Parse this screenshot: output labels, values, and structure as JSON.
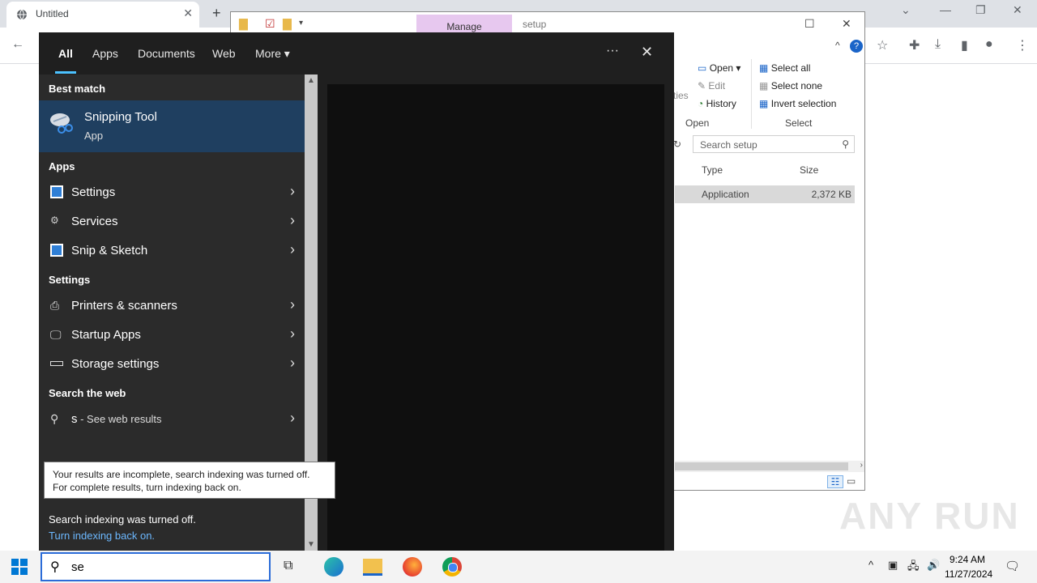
{
  "chrome": {
    "tab_title": "Untitled",
    "tab_close": "✕",
    "new_tab": "+"
  },
  "explorer": {
    "manage_tab": "Manage",
    "window_title": "setup",
    "ribbon": {
      "open": "Open",
      "edit": "Edit",
      "history": "History",
      "properties_partial": "rties",
      "open_group": "Open",
      "select_all": "Select all",
      "select_none": "Select none",
      "invert_selection": "Invert selection",
      "select_group": "Select"
    },
    "search_placeholder": "Search setup",
    "columns": {
      "type": "Type",
      "size": "Size"
    },
    "row": {
      "type": "Application",
      "size": "2,372 KB"
    }
  },
  "search_panel": {
    "tabs": [
      {
        "label": "All"
      },
      {
        "label": "Apps"
      },
      {
        "label": "Documents"
      },
      {
        "label": "Web"
      },
      {
        "label": "More"
      }
    ],
    "more_icon": "···",
    "close_icon": "✕",
    "best_match_heading": "Best match",
    "best_match": {
      "title": "Snipping Tool",
      "subtitle": "App"
    },
    "apps_heading": "Apps",
    "apps": [
      {
        "label": "Settings"
      },
      {
        "label": "Services"
      },
      {
        "label": "Snip & Sketch"
      }
    ],
    "settings_heading": "Settings",
    "settings": [
      {
        "label": "Printers & scanners"
      },
      {
        "label": "Startup Apps"
      },
      {
        "label": "Storage settings"
      }
    ],
    "web_heading": "Search the web",
    "web_query": "s",
    "web_suffix": " - See web results",
    "tooltip": "Your results are incomplete, search indexing was turned off. For complete results, turn indexing back on.",
    "indexing_off": "Search indexing was turned off.",
    "indexing_link": "Turn indexing back on."
  },
  "taskbar": {
    "search_value": "se",
    "time": "9:24 AM",
    "date": "11/27/2024"
  },
  "watermark": "ANY RUN"
}
